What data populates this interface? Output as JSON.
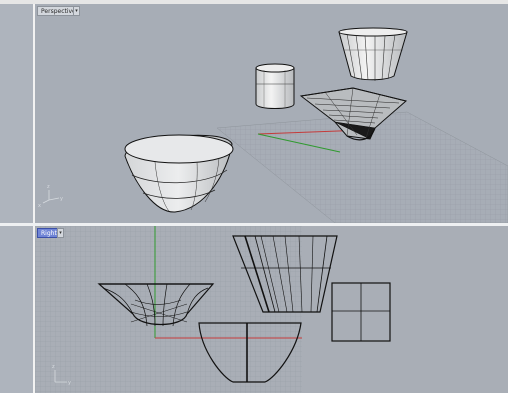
{
  "viewports": {
    "perspective": {
      "title": "Perspective"
    },
    "right": {
      "title": "Right"
    }
  },
  "axis_labels": {
    "x": "x",
    "y": "y",
    "z": "z"
  },
  "icons": {
    "menu": "dropdown-arrow-icon"
  },
  "colors": {
    "active_title_bg": "#6f84d6",
    "x_axis": "#c53a3a",
    "y_axis": "#2f9a2f",
    "grid": "#8a9096"
  }
}
